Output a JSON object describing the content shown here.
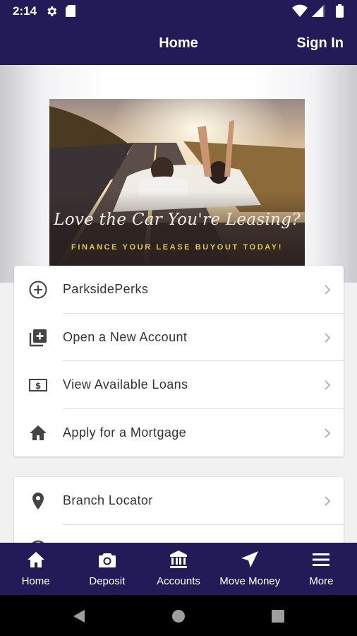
{
  "status_bar": {
    "time": "2:14"
  },
  "header": {
    "title": "Home",
    "sign_in": "Sign In"
  },
  "banner": {
    "headline": "Love the Car You're Leasing?",
    "subline": "FINANCE YOUR LEASE BUYOUT TODAY!"
  },
  "menu_primary": [
    {
      "label": "ParksidePerks",
      "icon": "plus-circle-icon"
    },
    {
      "label": "Open a New Account",
      "icon": "add-box-icon"
    },
    {
      "label": "View Available Loans",
      "icon": "dollar-bill-icon"
    },
    {
      "label": "Apply for a Mortgage",
      "icon": "home-icon"
    }
  ],
  "menu_secondary": [
    {
      "label": "Branch Locator",
      "icon": "location-pin-icon"
    }
  ],
  "bottom_nav": [
    {
      "label": "Home",
      "icon": "home-icon"
    },
    {
      "label": "Deposit",
      "icon": "camera-icon"
    },
    {
      "label": "Accounts",
      "icon": "bank-icon"
    },
    {
      "label": "Move Money",
      "icon": "navigation-arrow-icon"
    },
    {
      "label": "More",
      "icon": "menu-icon"
    }
  ],
  "colors": {
    "brand": "#231b57",
    "accent": "#d9c95b",
    "background": "#f1f1f1"
  }
}
